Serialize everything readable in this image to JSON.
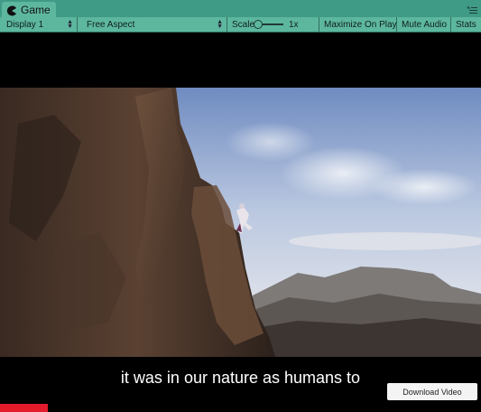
{
  "tab": {
    "title": "Game",
    "icon": "pacman-icon"
  },
  "toolbar": {
    "display": "Display 1",
    "aspect": "Free Aspect",
    "scale_label": "Scale",
    "scale_value": "1x",
    "maximize_on_play": "Maximize On Play",
    "mute_audio": "Mute Audio",
    "stats": "Stats"
  },
  "video": {
    "subtitle": "it was in our nature as humans to",
    "download_label": "Download Video",
    "progress_fraction": 0.1
  },
  "colors": {
    "tab_bar": "#3f9b86",
    "toolbar": "#5db79f",
    "progress": "#e31b2b"
  }
}
